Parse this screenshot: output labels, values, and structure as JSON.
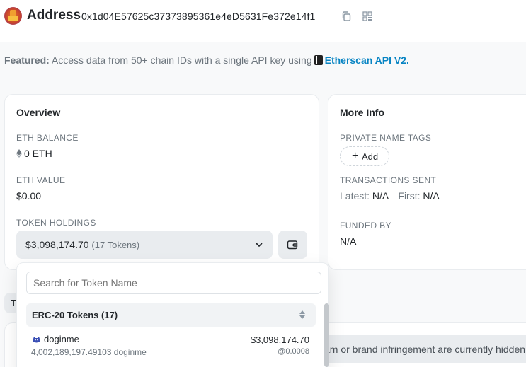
{
  "header": {
    "title": "Address",
    "address": "0x1d04E57625c37373895361e4eD5631Fe372e14f1",
    "copy_icon": "copy-icon",
    "qr_icon": "qr-code-icon"
  },
  "featured": {
    "label": "Featured:",
    "text": "Access data from 50+ chain IDs with a single API key using",
    "link": "Etherscan API V2."
  },
  "overview": {
    "title": "Overview",
    "eth_balance_label": "ETH BALANCE",
    "eth_balance_value": "0 ETH",
    "eth_value_label": "ETH VALUE",
    "eth_value_value": "$0.00",
    "token_holdings_label": "TOKEN HOLDINGS",
    "token_holdings_value": "$3,098,174.70",
    "token_holdings_count": "(17 Tokens)"
  },
  "more_info": {
    "title": "More Info",
    "private_tags_label": "PRIVATE NAME TAGS",
    "add_label": "Add",
    "tx_sent_label": "TRANSACTIONS SENT",
    "latest_label": "Latest:",
    "latest_value": "N/A",
    "first_label": "First:",
    "first_value": "N/A",
    "funded_by_label": "FUNDED BY",
    "funded_by_value": "N/A"
  },
  "dropdown": {
    "search_placeholder": "Search for Token Name",
    "group_label": "ERC-20 Tokens (17)",
    "tokens": [
      {
        "name": "doginme",
        "balance": "4,002,189,197.49103 doginme",
        "value": "$3,098,174.70",
        "price": "@0.0008"
      }
    ]
  },
  "tab_stub": "T",
  "notice_text": "am or brand infringement are currently hidden",
  "colors": {
    "accent": "#0784c3",
    "text": "#212529",
    "muted": "#6c757d",
    "panel": "#e9ecef"
  }
}
